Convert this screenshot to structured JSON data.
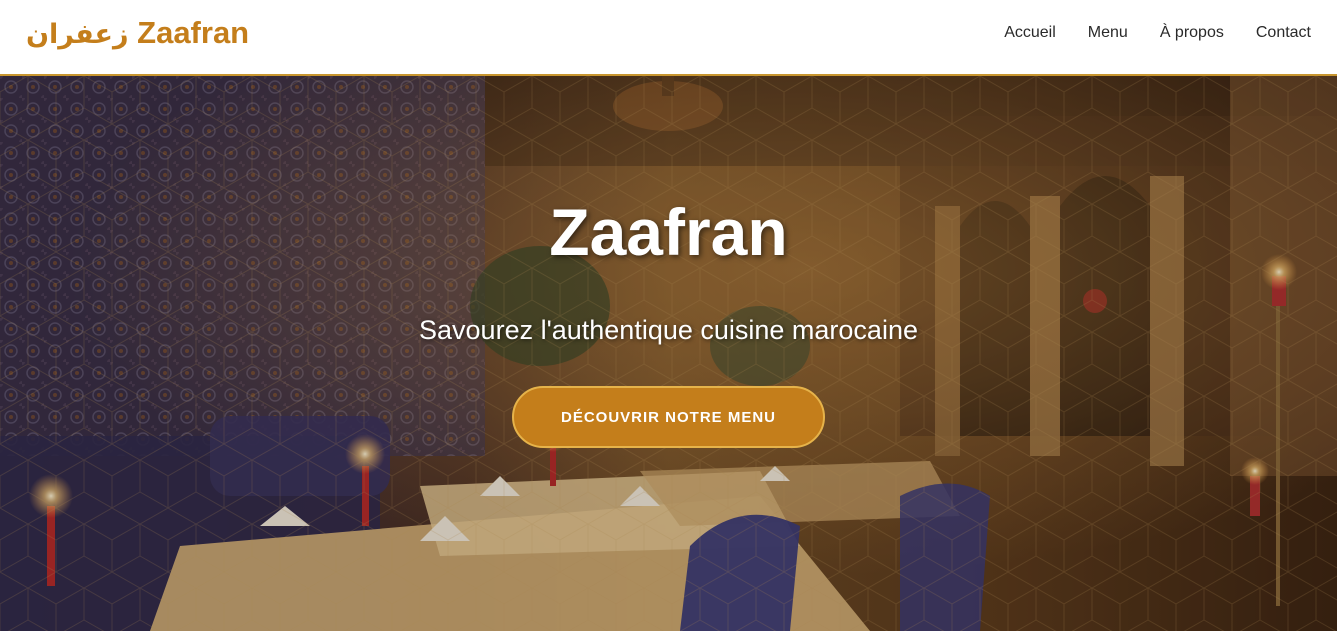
{
  "navbar": {
    "logo_arabic": "زعفران",
    "logo_text": "Zaafran",
    "links": [
      {
        "label": "Accueil"
      },
      {
        "label": "Menu"
      },
      {
        "label": "À propos"
      },
      {
        "label": "Contact"
      }
    ]
  },
  "hero": {
    "title": "Zaafran",
    "subtitle": "Savourez l'authentique cuisine marocaine",
    "cta_label": "DÉCOUVRIR NOTRE MENU",
    "background_image": "moroccan-restaurant-interior"
  },
  "colors": {
    "brand": "#c47e1b",
    "nav_border": "#c8962f",
    "nav_text": "#2a2a2a"
  }
}
